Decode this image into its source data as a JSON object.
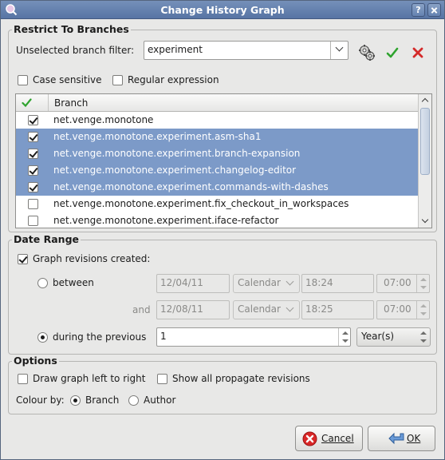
{
  "window": {
    "title": "Change History Graph"
  },
  "icons": {
    "app": "app-icon",
    "help": "help-icon",
    "close": "close-icon",
    "refresh": "gears-icon",
    "select_all": "checkmark-icon",
    "deselect_all": "x-icon",
    "cancel": "cancel-icon",
    "ok": "ok-arrow-icon"
  },
  "colors": {
    "titlebar": "#5e7aa8",
    "selection": "#7c9ac8",
    "accept": "#2ea32e",
    "reject": "#d42a2a"
  },
  "restrict": {
    "title": "Restrict To Branches",
    "filter_label": "Unselected branch filter:",
    "filter_value": "experiment",
    "case_sensitive": "Case sensitive",
    "regex": "Regular expression",
    "column_branch": "Branch",
    "rows": [
      {
        "name": "net.venge.monotone",
        "checked": true,
        "selected": false
      },
      {
        "name": "net.venge.monotone.experiment.asm-sha1",
        "checked": true,
        "selected": true
      },
      {
        "name": "net.venge.monotone.experiment.branch-expansion",
        "checked": true,
        "selected": true
      },
      {
        "name": "net.venge.monotone.experiment.changelog-editor",
        "checked": true,
        "selected": true
      },
      {
        "name": "net.venge.monotone.experiment.commands-with-dashes",
        "checked": true,
        "selected": true
      },
      {
        "name": "net.venge.monotone.experiment.fix_checkout_in_workspaces",
        "checked": false,
        "selected": false
      },
      {
        "name": "net.venge.monotone.experiment.iface-refactor",
        "checked": false,
        "selected": false
      }
    ]
  },
  "date_range": {
    "title": "Date Range",
    "graph_label": "Graph revisions created:",
    "between_label": "between",
    "and_label": "and",
    "from_date": "12/04/11",
    "from_calendar": "Calendar",
    "from_time": "18:24",
    "from_tz": "07:00",
    "to_date": "12/08/11",
    "to_calendar": "Calendar",
    "to_time": "18:25",
    "to_tz": "07:00",
    "during_label": "during the previous",
    "during_value": "1",
    "unit": "Year(s)"
  },
  "options": {
    "title": "Options",
    "draw_left_to_right": "Draw graph left to right",
    "show_propagate": "Show all propagate revisions",
    "colour_by": "Colour by:",
    "branch": "Branch",
    "author": "Author"
  },
  "buttons": {
    "cancel": "Cancel",
    "ok": "OK"
  }
}
